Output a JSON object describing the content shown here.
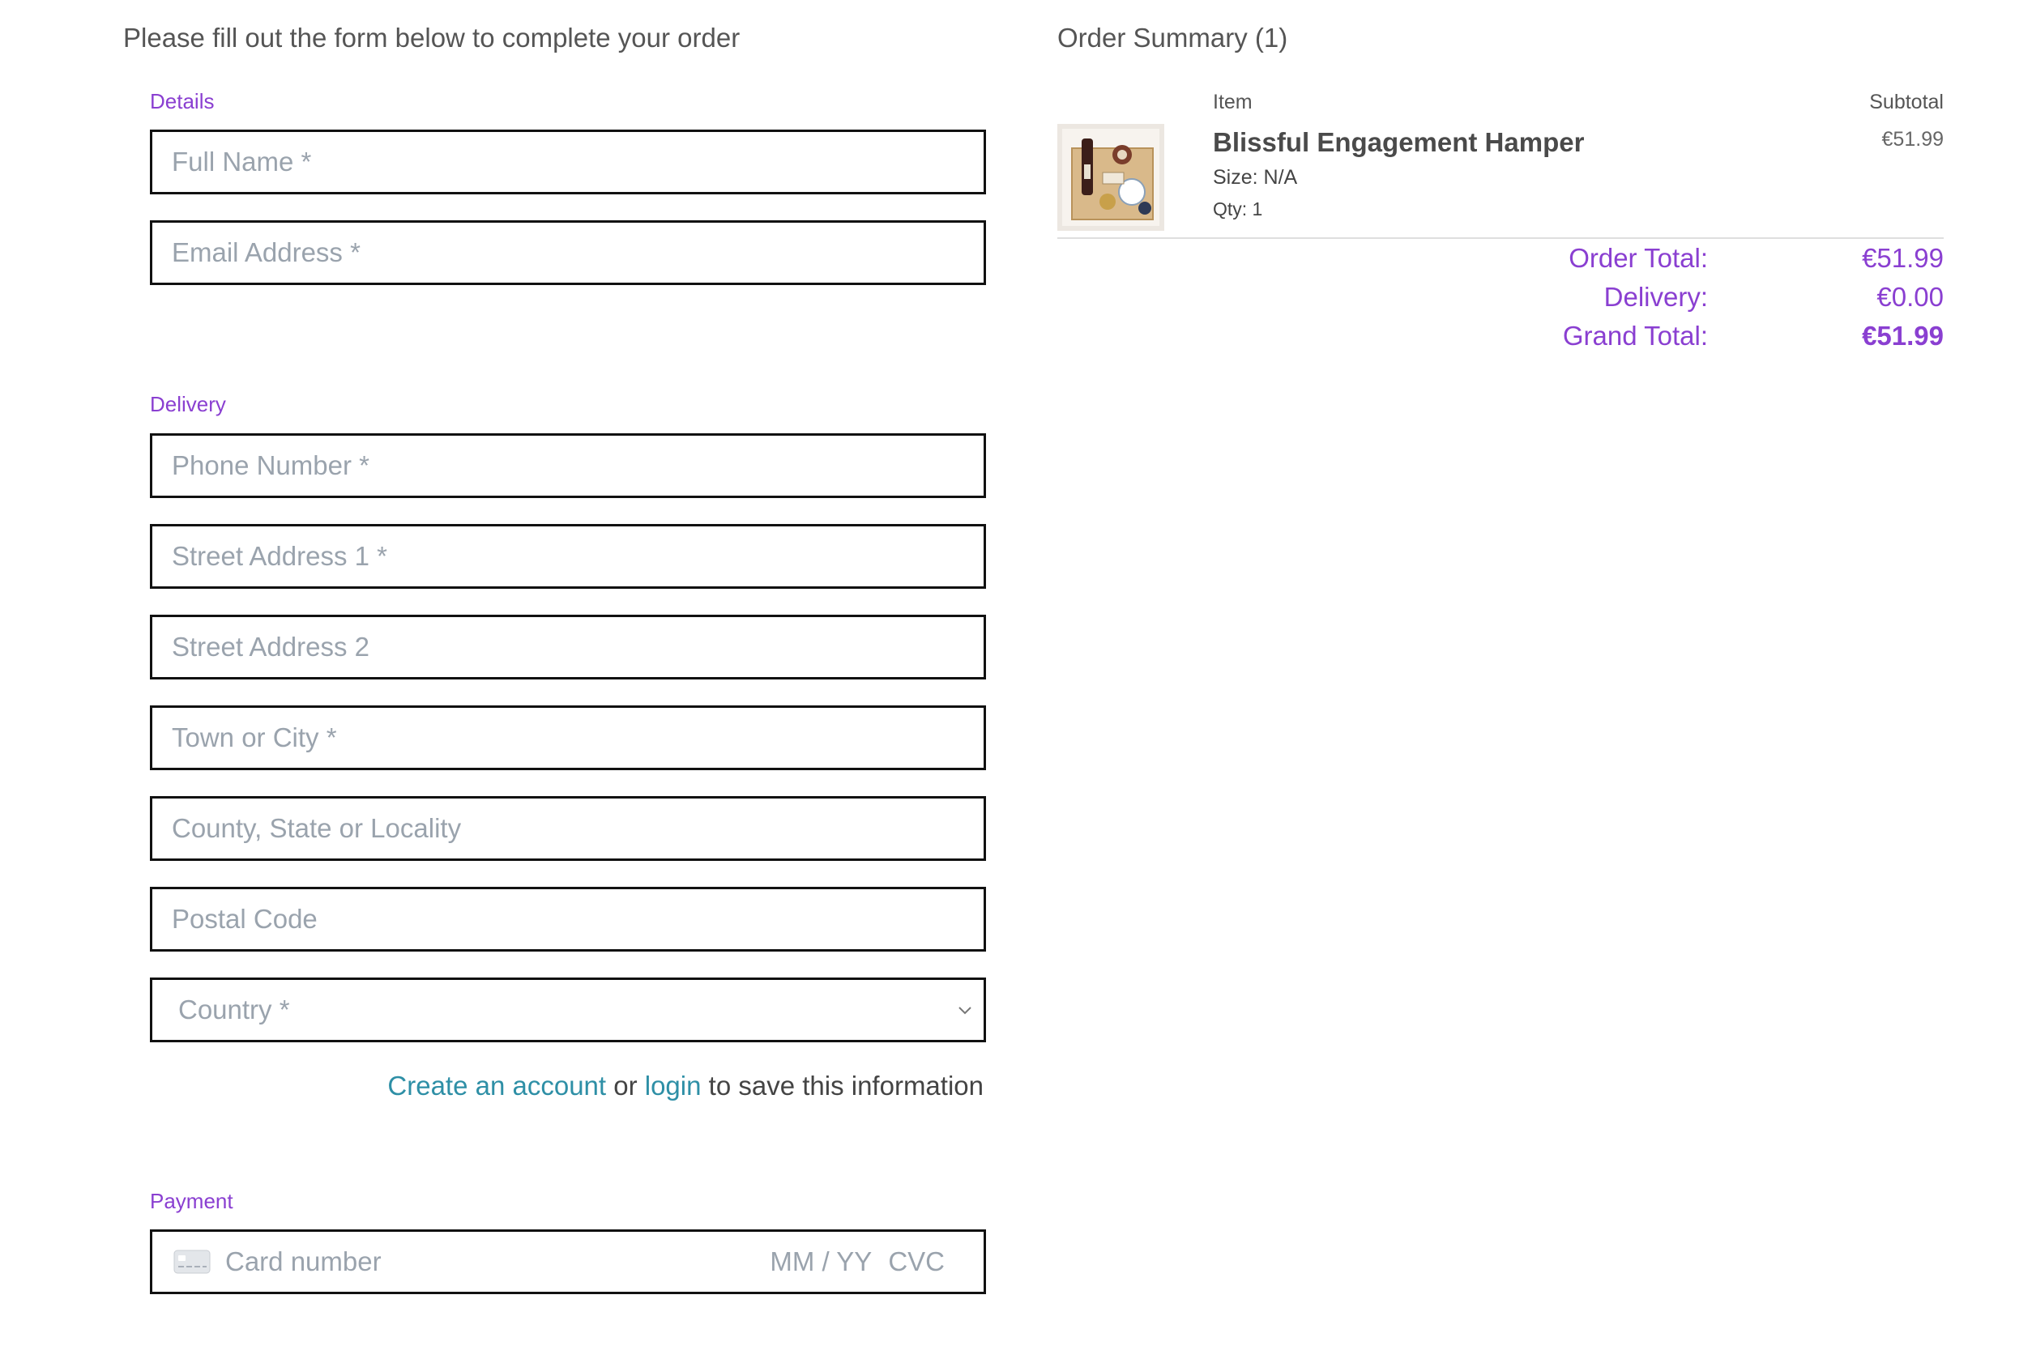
{
  "form": {
    "intro": "Please fill out the form below to complete your order",
    "details_label": "Details",
    "delivery_label": "Delivery",
    "payment_label": "Payment",
    "fields": {
      "full_name": "Full Name *",
      "email": "Email Address *",
      "phone": "Phone Number *",
      "street1": "Street Address 1 *",
      "street2": "Street Address 2",
      "town": "Town or City *",
      "county": "County, State or Locality",
      "postal": "Postal Code",
      "country": "Country *"
    },
    "account_prompt": {
      "create_link": "Create an account",
      "or": "or",
      "login_link": "login",
      "suffix": "to save this information"
    },
    "card": {
      "placeholder": "Card number",
      "expiry_placeholder": "MM / YY",
      "cvc_placeholder": "CVC",
      "icon": "credit-card-icon"
    }
  },
  "summary": {
    "title": "Order Summary (1)",
    "col_item": "Item",
    "col_subtotal": "Subtotal",
    "product": {
      "name": "Blissful Engagement Hamper",
      "size": "Size: N/A",
      "qty": "Qty: 1",
      "subtotal": "€51.99"
    },
    "order_total_label": "Order Total:",
    "order_total": "€51.99",
    "delivery_label": "Delivery:",
    "delivery": "€0.00",
    "grand_total_label": "Grand Total:",
    "grand_total": "€51.99"
  },
  "colors": {
    "accent": "#8a3fd1",
    "link": "#2e8fa6",
    "border": "#111111"
  }
}
